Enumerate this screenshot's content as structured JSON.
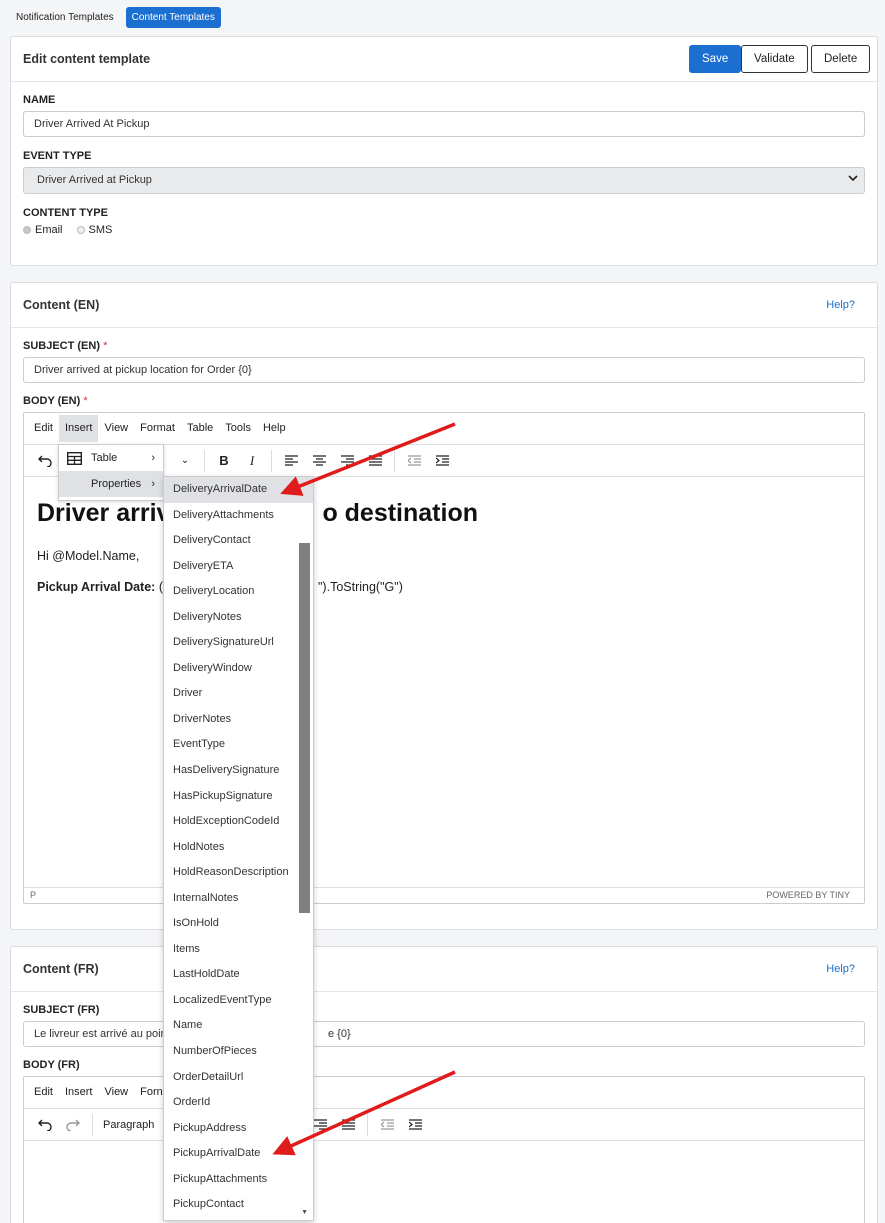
{
  "tabs": [
    "Notification Templates",
    "Content Templates"
  ],
  "edit_panel": {
    "title": "Edit content template",
    "save": "Save",
    "validate": "Validate",
    "delete": "Delete",
    "name_label": "NAME",
    "name_value": "Driver Arrived At Pickup",
    "event_type_label": "EVENT TYPE",
    "event_type_value": "Driver Arrived at Pickup",
    "content_type_label": "CONTENT TYPE",
    "content_type_options": [
      "Email",
      "SMS"
    ]
  },
  "content_en": {
    "title": "Content (EN)",
    "help": "Help?",
    "subject_label": "SUBJECT (EN)",
    "subject_value": "Driver arrived at pickup location for Order {0}",
    "body_label": "BODY (EN)",
    "menus": [
      "Edit",
      "Insert",
      "View",
      "Format",
      "Table",
      "Tools",
      "Help"
    ],
    "heading_left": "Driver arriv",
    "heading_right": "o destination",
    "greeting": "Hi @Model.Name,",
    "pickup_label": "Pickup Arrival Date:",
    "pickup_prefix": "(",
    "pickup_suffix": "\").ToString(\"G\")",
    "status_path": "P",
    "powered": "POWERED BY TINY"
  },
  "content_fr": {
    "title": "Content (FR)",
    "help": "Help?",
    "subject_label": "SUBJECT (FR)",
    "subject_value_left": "Le livreur est arrivé au poir",
    "subject_value_right": "e {0}",
    "body_label": "BODY (FR)",
    "menus": [
      "Edit",
      "Insert",
      "View",
      "Forn"
    ],
    "block_format": "Paragraph"
  },
  "insert_menu": {
    "items": [
      {
        "icon": "table-icon",
        "label": "Table"
      },
      {
        "label": "Properties"
      }
    ]
  },
  "properties": [
    "DeliveryArrivalDate",
    "DeliveryAttachments",
    "DeliveryContact",
    "DeliveryETA",
    "DeliveryLocation",
    "DeliveryNotes",
    "DeliverySignatureUrl",
    "DeliveryWindow",
    "Driver",
    "DriverNotes",
    "EventType",
    "HasDeliverySignature",
    "HasPickupSignature",
    "HoldExceptionCodeId",
    "HoldNotes",
    "HoldReasonDescription",
    "InternalNotes",
    "IsOnHold",
    "Items",
    "LastHoldDate",
    "LocalizedEventType",
    "Name",
    "NumberOfPieces",
    "OrderDetailUrl",
    "OrderId",
    "PickupAddress",
    "PickupArrivalDate",
    "PickupAttachments",
    "PickupContact"
  ],
  "colors": {
    "primary": "#1a6fd1",
    "annotation": "#e01b1b"
  }
}
